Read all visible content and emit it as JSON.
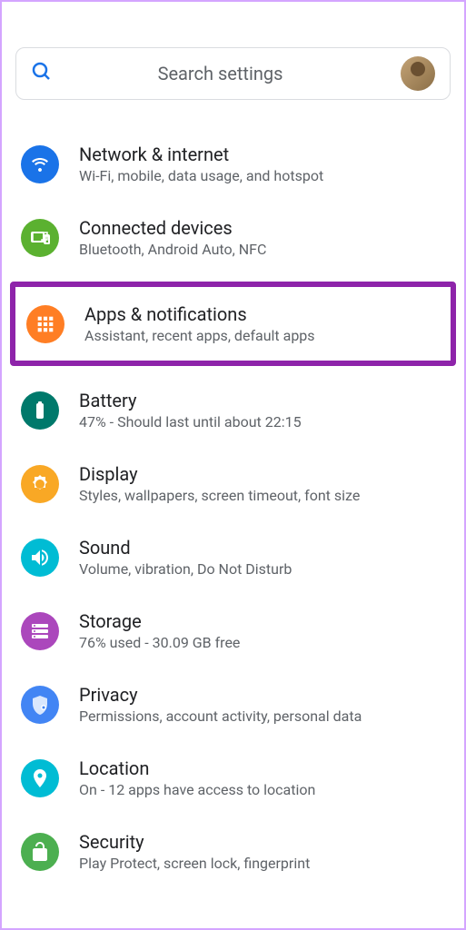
{
  "search": {
    "placeholder": "Search settings"
  },
  "items": [
    {
      "title": "Network & internet",
      "subtitle": "Wi-Fi, mobile, data usage, and hotspot"
    },
    {
      "title": "Connected devices",
      "subtitle": "Bluetooth, Android Auto, NFC"
    },
    {
      "title": "Apps & notifications",
      "subtitle": "Assistant, recent apps, default apps"
    },
    {
      "title": "Battery",
      "subtitle": "47% - Should last until about 22:15"
    },
    {
      "title": "Display",
      "subtitle": "Styles, wallpapers, screen timeout, font size"
    },
    {
      "title": "Sound",
      "subtitle": "Volume, vibration, Do Not Disturb"
    },
    {
      "title": "Storage",
      "subtitle": "76% used - 30.09 GB free"
    },
    {
      "title": "Privacy",
      "subtitle": "Permissions, account activity, personal data"
    },
    {
      "title": "Location",
      "subtitle": "On - 12 apps have access to location"
    },
    {
      "title": "Security",
      "subtitle": "Play Protect, screen lock, fingerprint"
    }
  ]
}
